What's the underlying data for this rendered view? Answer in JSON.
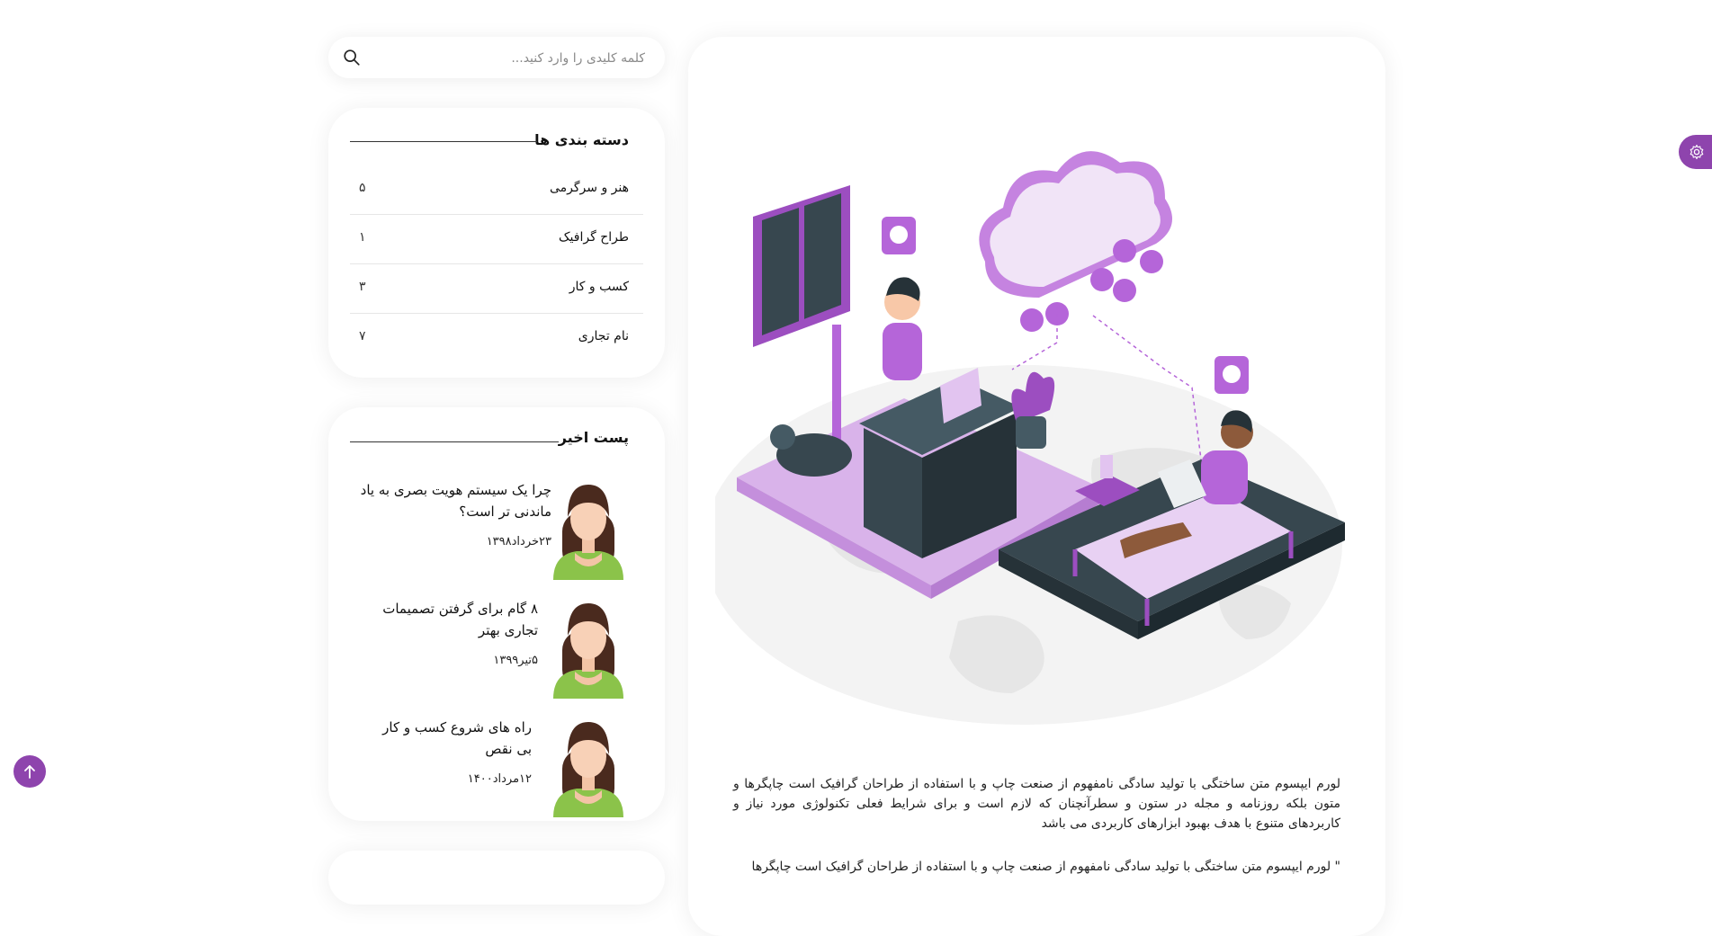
{
  "search": {
    "placeholder": "کلمه کلیدی را وارد کنید..."
  },
  "categories": {
    "title": "دسته بندی ها",
    "items": [
      {
        "name": "هنر و سرگرمی",
        "count": "۵"
      },
      {
        "name": "طراح گرافیک",
        "count": "۱"
      },
      {
        "name": "کسب و کار",
        "count": "۳"
      },
      {
        "name": "نام تجاری",
        "count": "۷"
      }
    ]
  },
  "recent": {
    "title": "پست اخیر",
    "posts": [
      {
        "title": "چرا یک سیستم هویت بصری به یاد ماندنی تر است؟",
        "date": "۲۳خرداد۱۳۹۸"
      },
      {
        "title": "۸ گام برای گرفتن تصمیمات تجاری بهتر",
        "date": "۵تیر۱۳۹۹"
      },
      {
        "title": "راه های شروع کسب و کار بی نقص",
        "date": "۱۲مرداد۱۴۰۰"
      }
    ]
  },
  "article": {
    "paragraph1": "لورم ایپسوم متن ساختگی با تولید سادگی نامفهوم از صنعت چاپ و با استفاده از طراحان گرافیک است چاپگرها و متون بلکه روزنامه و مجله در ستون و سطرآنچنان که لازم است و برای شرایط فعلی تکنولوژی مورد نیاز و کاربردهای متنوع با هدف بهبود ابزارهای کاربردی می باشد",
    "paragraph2": "\" لورم ایپسوم متن ساختگی با تولید سادگی نامفهوم از صنعت چاپ و با استفاده از طراحان گرافیک است چاپگرها"
  },
  "colors": {
    "accent": "#8e44ad",
    "illustration_purple": "#b565d9",
    "dark_slate": "#37474f"
  },
  "icons": {
    "search": "search-icon",
    "settings": "gear-icon",
    "back_to_top": "arrow-up-icon"
  }
}
